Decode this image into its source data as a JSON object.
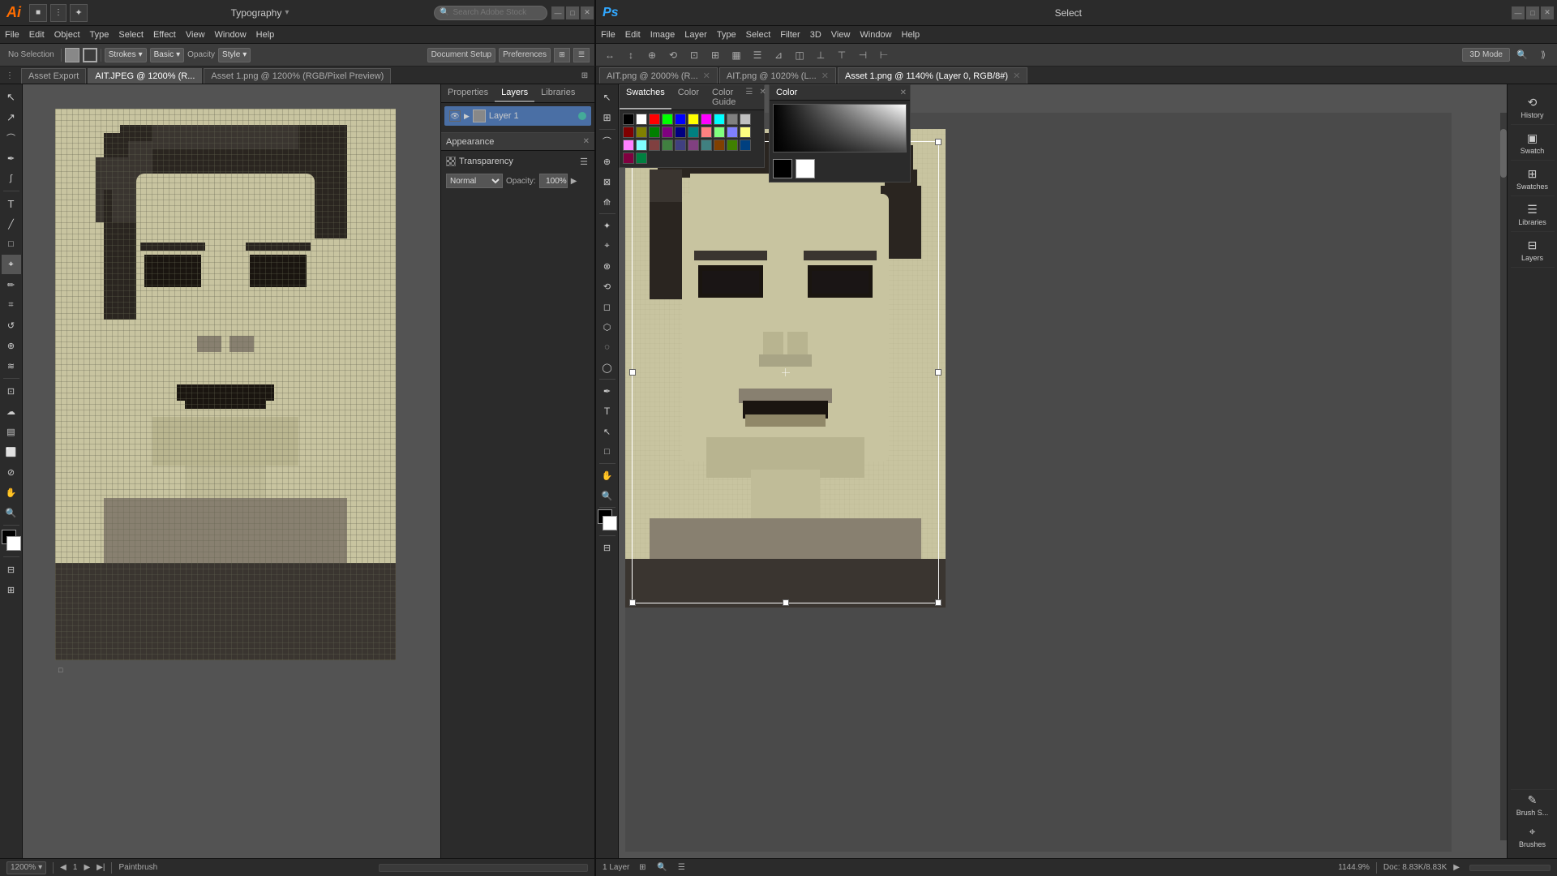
{
  "app": {
    "ai_logo": "Ai",
    "ps_logo": "Ps",
    "title_ai": "Typography",
    "title_ps": "Select"
  },
  "ai_menu": [
    "File",
    "Edit",
    "Object",
    "Type",
    "Select",
    "Effect",
    "View",
    "Window",
    "Help"
  ],
  "ai_toolbar_top": {
    "no_selection": "No Selection",
    "strokes_label": "Strokes",
    "basic_label": "Basic",
    "opacity_label": "Opacity",
    "style_label": "Style",
    "document_setup": "Document Setup",
    "preferences": "Preferences",
    "search_placeholder": "Search Adobe Stock"
  },
  "ai_tabs": [
    {
      "label": "AIT.JPEG @ 1200% (R...",
      "active": true
    },
    {
      "label": "Asset 1.png @ 1200% (RGB/Pixel Preview)",
      "active": false
    }
  ],
  "ai_panel_tabs": [
    "Properties",
    "Layers",
    "Libraries"
  ],
  "appearance_panel": {
    "title": "Appearance",
    "transparency": "Transparency",
    "blending_mode": "Normal",
    "opacity_label": "Opacity:",
    "opacity_value": "100%"
  },
  "layers_panel": {
    "layers_tab": "Layers",
    "layer1": "Layer 1",
    "visible": true
  },
  "ai_statusbar": {
    "zoom": "1200%",
    "page": "1",
    "artboard": "1",
    "brush": "Paintbrush"
  },
  "ps_menu": [
    "File",
    "Edit",
    "Image",
    "Layer",
    "Type",
    "Select",
    "Filter",
    "3D",
    "View",
    "Window",
    "Help"
  ],
  "ps_tabs": [
    {
      "label": "AIT.png @ 2000% (R...",
      "active": false
    },
    {
      "label": "AIT.png @ 1020% (L...",
      "active": false
    },
    {
      "label": "Asset 1.png @ 1140% (Layer 0, RGB/8#)",
      "active": true
    }
  ],
  "ps_transform": {
    "mode_3d": "3D Mode"
  },
  "ps_right_panels": [
    {
      "label": "History",
      "icon": "⟲"
    },
    {
      "label": "Swatch",
      "icon": "▣"
    },
    {
      "label": "Swatches",
      "icon": "▣"
    },
    {
      "label": "Libraries",
      "icon": "☰"
    },
    {
      "label": "Layers",
      "icon": "⊞"
    }
  ],
  "swatches": {
    "tab_swatches": "Swatches",
    "tab_color": "Color",
    "tab_guide": "Color Guide",
    "colors": [
      "#000000",
      "#ffffff",
      "#ff0000",
      "#00ff00",
      "#0000ff",
      "#ffff00",
      "#ff00ff",
      "#00ffff",
      "#808080",
      "#c0c0c0",
      "#800000",
      "#808000",
      "#008000",
      "#800080",
      "#000080",
      "#008080",
      "#ff8080",
      "#80ff80",
      "#8080ff",
      "#ffff80",
      "#ff80ff",
      "#80ffff",
      "#804040",
      "#408040",
      "#404080",
      "#804080",
      "#408080",
      "#804000",
      "#408000",
      "#004080",
      "#800040",
      "#008040"
    ]
  },
  "ps_statusbar": {
    "zoom": "1144.9%",
    "layers": "1 Layer",
    "doc_size": "Doc: 8.83K/8.83K"
  },
  "bottom_panels": {
    "brush_s": "Brush S...",
    "brushes": "Brushes"
  },
  "face_image": {
    "description": "pixelated face portrait in olive/tan tones"
  }
}
